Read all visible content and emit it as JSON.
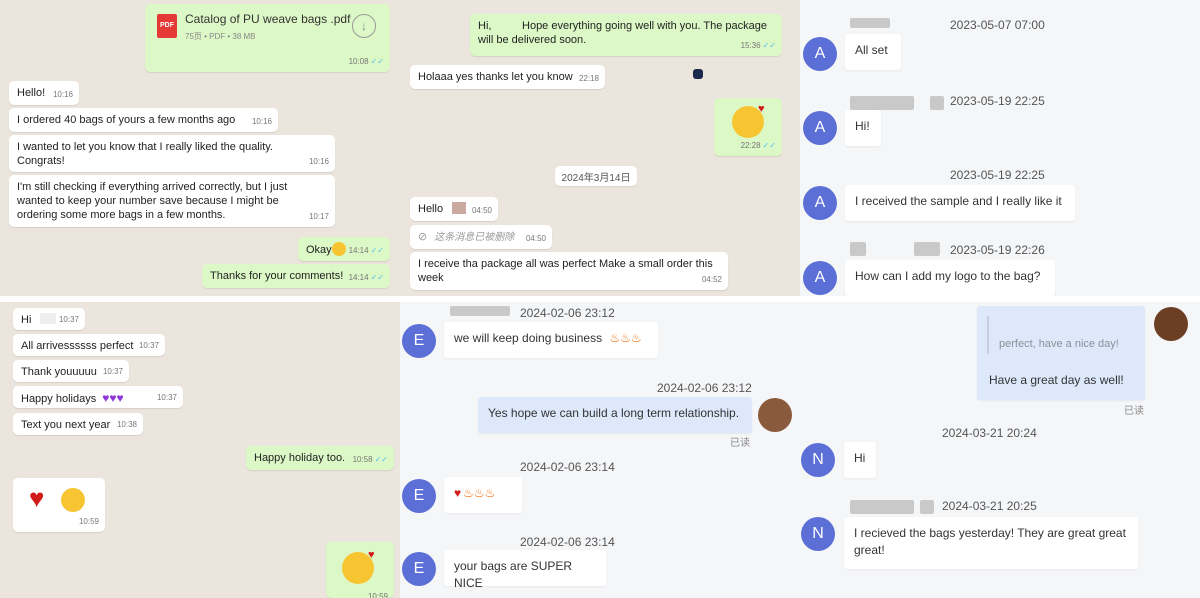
{
  "p1": {
    "file_name": "Catalog of PU weave bags .pdf",
    "file_meta": "75页 • PDF • 38 MB",
    "file_badge": "PDF",
    "file_time": "10:08",
    "msgs": [
      {
        "text": "Hello!",
        "time": "10:16"
      },
      {
        "text": "I ordered 40 bags of yours a few months ago",
        "time": "10:16"
      },
      {
        "text": "I wanted to let you know that I really liked the quality. Congrats!",
        "time": "10:16"
      },
      {
        "text": "I'm still checking if everything arrived correctly, but I just wanted to keep your number save because I might be ordering some more bags in a few months.",
        "time": "10:17"
      },
      {
        "text": "Okay",
        "time": "14:14"
      },
      {
        "text": "Thanks for your comments!",
        "time": "14:14"
      }
    ]
  },
  "p2": {
    "msgs": [
      {
        "text": "Hi,          Hope everything going well with you. The package will be delivered soon.",
        "time": "15:36"
      },
      {
        "text": "Holaaa yes thanks let you know",
        "time": "22:18"
      },
      {
        "text": "",
        "time": "22:28"
      },
      {
        "text": "Hello",
        "time": "04:50"
      },
      {
        "text": "这条消息已被删除",
        "time": "04:50"
      },
      {
        "text": "I receive tha package all was perfect Make a small order this week",
        "time": "04:52"
      }
    ],
    "date_chip": "2024年3月14日"
  },
  "p3": {
    "avatar_letter": "A",
    "stamps": [
      "2023-05-07 07:00",
      "2023-05-19 22:25",
      "2023-05-19 22:25",
      "2023-05-19 22:26"
    ],
    "msgs": [
      "All set",
      "Hi!",
      "I received the sample and I really like it",
      "How can I add my logo to the bag?"
    ]
  },
  "p4": {
    "msgs": [
      {
        "text": "Hi",
        "time": "10:37"
      },
      {
        "text": "All arrivessssss perfect",
        "time": "10:37"
      },
      {
        "text": "Thank youuuuu",
        "time": "10:37"
      },
      {
        "text": "Happy holidays",
        "time": "10:37"
      },
      {
        "text": "Text you next year",
        "time": "10:38"
      },
      {
        "text": "Happy holiday too.",
        "time": "10:58"
      },
      {
        "text": "",
        "time": "10:59"
      }
    ],
    "partial_time": "10:59"
  },
  "p5": {
    "avatar_letter": "E",
    "stamps": [
      "2024-02-06 23:12",
      "2024-02-06 23:12",
      "2024-02-06 23:14",
      "2024-02-06 23:14"
    ],
    "msgs": [
      "we will keep doing business",
      "Yes hope we can build a long term relationship.",
      "",
      "your bags are SUPER NICE"
    ],
    "read_label": "已读"
  },
  "p6": {
    "avatar_letter": "N",
    "quote_text": "perfect, have a nice day!",
    "reply_text": "Have a great day as well!",
    "read_label": "已读",
    "stamps": [
      "2024-03-21 20:24",
      "2024-03-21 20:25"
    ],
    "msgs": [
      "Hi",
      "I recieved the bags yesterday! They are great great great!"
    ]
  },
  "colors": {
    "wa_bg": "#ece5dd",
    "wa_out": "#dcf8c6",
    "avatar": "#5b6fd6",
    "my_bubble": "#dde9fb",
    "tick": "#4fc3f7"
  }
}
